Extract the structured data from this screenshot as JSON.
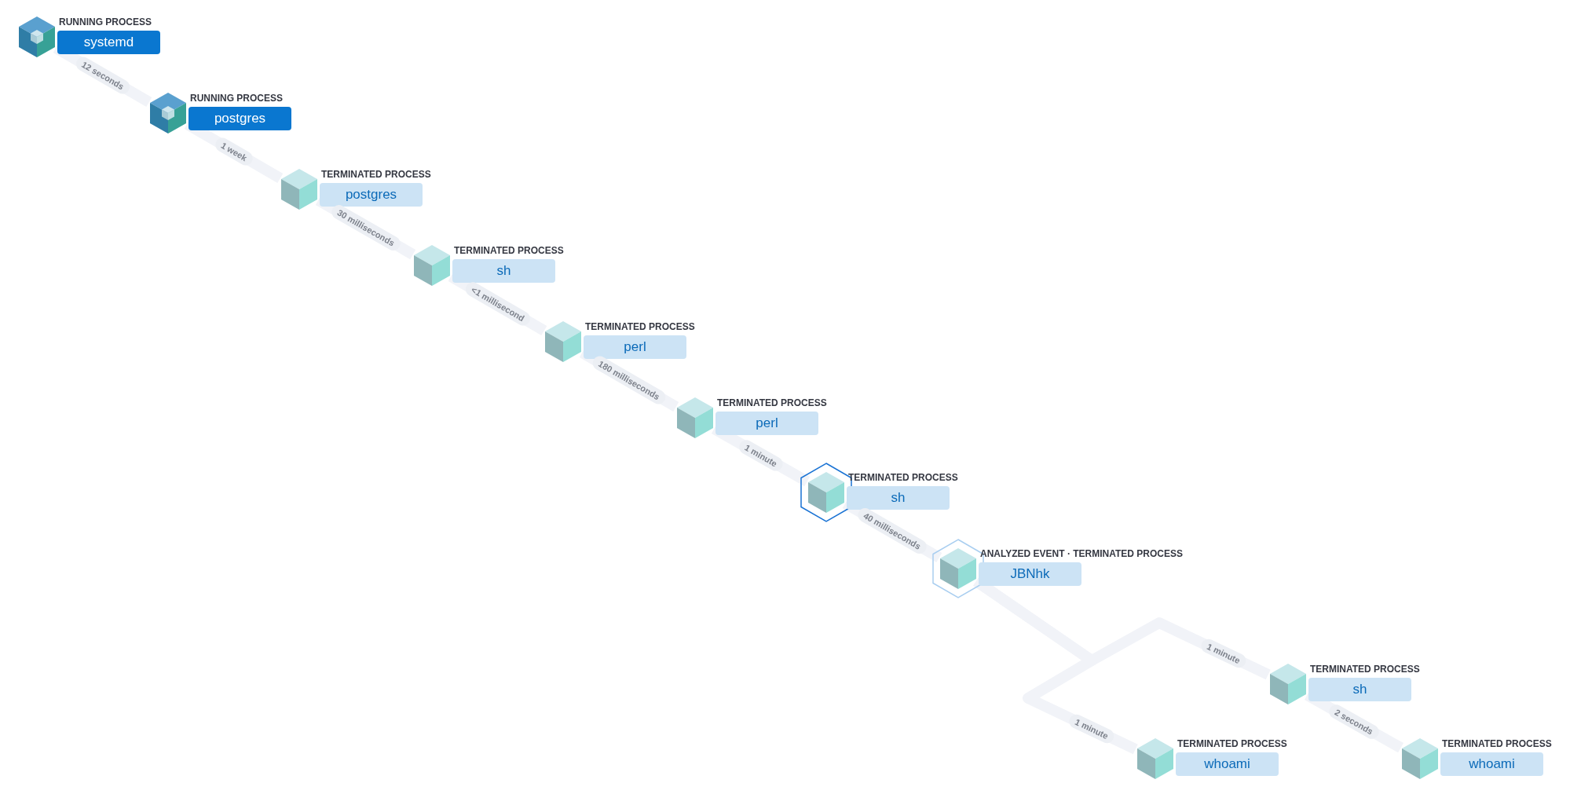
{
  "process_tree": {
    "state_label": "RUNNING PROCESS",
    "name": "systemd",
    "kind": "running",
    "selected": false,
    "origin": false,
    "children": [
      {
        "elapsed": "12 seconds",
        "state_label": "RUNNING PROCESS",
        "name": "postgres",
        "kind": "running",
        "selected": false,
        "origin": false,
        "children": [
          {
            "elapsed": "1 week",
            "state_label": "TERMINATED PROCESS",
            "name": "postgres",
            "kind": "terminated",
            "selected": false,
            "origin": false,
            "children": [
              {
                "elapsed": "30 milliseconds",
                "state_label": "TERMINATED PROCESS",
                "name": "sh",
                "kind": "terminated",
                "selected": false,
                "origin": false,
                "children": [
                  {
                    "elapsed": "<1 millisecond",
                    "state_label": "TERMINATED PROCESS",
                    "name": "perl",
                    "kind": "terminated",
                    "selected": false,
                    "origin": false,
                    "children": [
                      {
                        "elapsed": "180 milliseconds",
                        "state_label": "TERMINATED PROCESS",
                        "name": "perl",
                        "kind": "terminated",
                        "selected": false,
                        "origin": false,
                        "children": [
                          {
                            "elapsed": "1 minute",
                            "state_label": "TERMINATED PROCESS",
                            "name": "sh",
                            "kind": "terminated",
                            "selected": true,
                            "origin": false,
                            "children": [
                              {
                                "elapsed": "40 milliseconds",
                                "state_label": "ANALYZED EVENT · TERMINATED PROCESS",
                                "name": "JBNhk",
                                "kind": "terminated",
                                "selected": false,
                                "origin": true,
                                "children": [
                                  {
                                    "elapsed": "1 minute",
                                    "state_label": "TERMINATED PROCESS",
                                    "name": "sh",
                                    "kind": "terminated",
                                    "selected": false,
                                    "origin": false,
                                    "children": [
                                      {
                                        "elapsed": "2 seconds",
                                        "state_label": "TERMINATED PROCESS",
                                        "name": "whoami",
                                        "kind": "terminated",
                                        "selected": false,
                                        "origin": false
                                      }
                                    ]
                                  },
                                  {
                                    "elapsed": "1 minute",
                                    "state_label": "TERMINATED PROCESS",
                                    "name": "whoami",
                                    "kind": "terminated",
                                    "selected": false,
                                    "origin": false
                                  }
                                ]
                              }
                            ]
                          }
                        ]
                      }
                    ]
                  }
                ]
              }
            ]
          }
        ]
      }
    ]
  }
}
